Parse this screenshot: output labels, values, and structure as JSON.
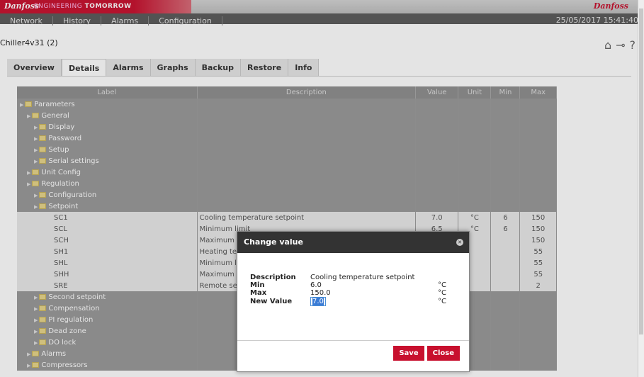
{
  "banner": {
    "logo": "Danfoss",
    "tagline_prefix": "ENGINEERING",
    "tagline_bold": "TOMORROW",
    "logo_right": "Danfoss"
  },
  "nav": {
    "items": [
      "Network",
      "History",
      "Alarms",
      "Configuration"
    ],
    "datetime": "25/05/2017 15:41:40"
  },
  "breadcrumb": "Chiller4v31 (2)",
  "tabs": [
    "Overview",
    "Details",
    "Alarms",
    "Graphs",
    "Backup",
    "Restore",
    "Info"
  ],
  "table": {
    "headers": [
      "Label",
      "Description",
      "Value",
      "Unit",
      "Min",
      "Max"
    ],
    "rows": [
      {
        "label": "Parameters",
        "type": "folder"
      },
      {
        "label": "General",
        "type": "folder"
      },
      {
        "label": "Display",
        "type": "folder"
      },
      {
        "label": "Password",
        "type": "folder"
      },
      {
        "label": "Setup",
        "type": "folder"
      },
      {
        "label": "Serial settings",
        "type": "folder"
      },
      {
        "label": "Unit Config",
        "type": "folder"
      },
      {
        "label": "Regulation",
        "type": "folder"
      },
      {
        "label": "Configuration",
        "type": "folder"
      },
      {
        "label": "Setpoint",
        "type": "folder"
      },
      {
        "label": "SC1",
        "desc": "Cooling temperature setpoint",
        "value": "7.0",
        "unit": "°C",
        "min": "6",
        "max": "150"
      },
      {
        "label": "SCL",
        "desc": "Minimum limit",
        "value": "6.5",
        "unit": "°C",
        "min": "6",
        "max": "150"
      },
      {
        "label": "SCH",
        "desc": "Maximum limit",
        "value": "",
        "unit": "",
        "min": "",
        "max": "150"
      },
      {
        "label": "SH1",
        "desc": "Heating temperature setpoint",
        "value": "",
        "unit": "",
        "min": "",
        "max": "55"
      },
      {
        "label": "SHL",
        "desc": "Minimum limit",
        "value": "",
        "unit": "",
        "min": "",
        "max": "55"
      },
      {
        "label": "SHH",
        "desc": "Maximum limit",
        "value": "",
        "unit": "",
        "min": "",
        "max": "55"
      },
      {
        "label": "SRE",
        "desc": "Remote set enable",
        "value": "",
        "unit": "",
        "min": "",
        "max": "2"
      },
      {
        "label": "Second setpoint",
        "type": "folder"
      },
      {
        "label": "Compensation",
        "type": "folder"
      },
      {
        "label": "PI regulation",
        "type": "folder"
      },
      {
        "label": "Dead zone",
        "type": "folder"
      },
      {
        "label": "DO lock",
        "type": "folder"
      },
      {
        "label": "Alarms",
        "type": "folder"
      },
      {
        "label": "Compressors",
        "type": "folder"
      }
    ]
  },
  "dialog": {
    "title": "Change value",
    "description_label": "Description",
    "description_value": "Cooling temperature setpoint",
    "min_label": "Min",
    "min_value": "6.0",
    "max_label": "Max",
    "max_value": "150.0",
    "new_label": "New Value",
    "new_value": "7.0",
    "unit": "°C",
    "save_label": "Save",
    "close_label": "Close"
  }
}
